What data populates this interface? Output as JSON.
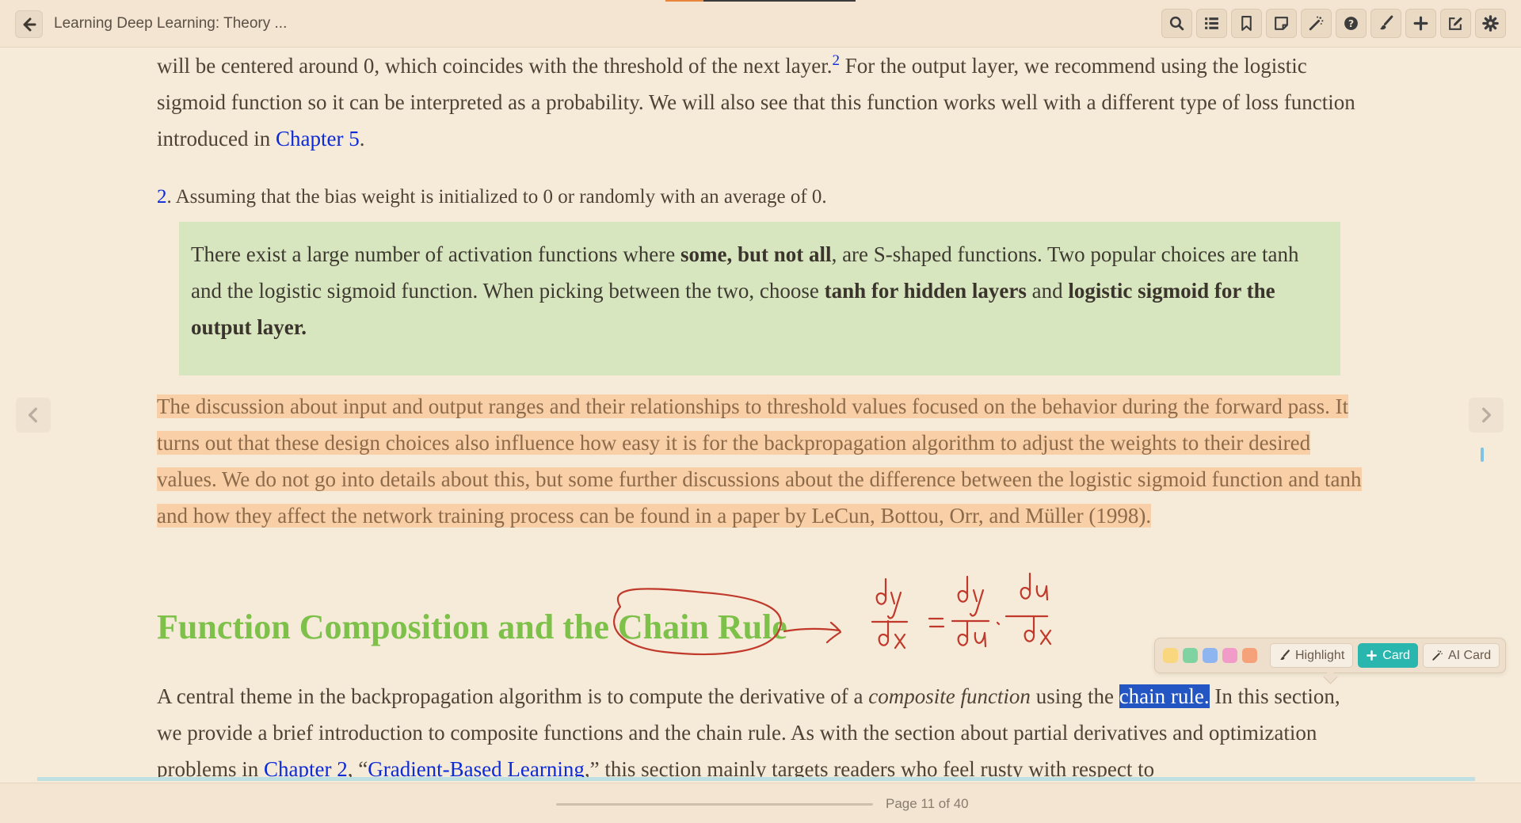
{
  "header": {
    "title": "Learning Deep Learning: Theory ...",
    "toolbar": [
      {
        "name": "search",
        "icon": "search-icon"
      },
      {
        "name": "table-of-contents",
        "icon": "list-icon"
      },
      {
        "name": "bookmarks",
        "icon": "bookmark-icon"
      },
      {
        "name": "notes",
        "icon": "note-icon"
      },
      {
        "name": "ai",
        "icon": "magic-wand-icon"
      },
      {
        "name": "help",
        "icon": "question-icon"
      },
      {
        "name": "draw",
        "icon": "brush-icon"
      },
      {
        "name": "add",
        "icon": "plus-icon"
      },
      {
        "name": "edit",
        "icon": "edit-icon"
      },
      {
        "name": "settings",
        "icon": "gear-icon"
      }
    ]
  },
  "content": {
    "p1": {
      "a": "will be centered around 0, which coincides with the threshold of the next layer.",
      "fn": "2",
      "b": " For the output layer, we recommend using the logistic sigmoid function so it can be interpreted as a probability. We will also see that this function works well with a different type of loss function introduced in ",
      "link": "Chapter 5",
      "c": "."
    },
    "footnote": {
      "num": "2",
      "text": ". Assuming that the bias weight is initialized to 0 or randomly with an average of 0."
    },
    "callout": {
      "t1": "There exist a large number of activation functions where ",
      "b1": "some, but not all",
      "t2": ", are S-shaped functions. Two popular choices are tanh and the logistic sigmoid function. When picking between the two, choose ",
      "b2": "tanh for hidden layers",
      "t3": " and ",
      "b3": "logistic sigmoid for the output layer."
    },
    "highlighted_paragraph": "The discussion about input and output ranges and their relationships to threshold values focused on the behavior during the forward pass. It turns out that these design choices also influence how easy it is for the backpropagation algorithm to adjust the weights to their desired values. We do not go into details about this, but some further discussions about the difference between the logistic sigmoid function and tanh and how they affect the network training process can be found in a paper by LeCun, Bottou, Orr, and Müller (1998).",
    "section_heading": "Function Composition and the Chain Rule",
    "p3": {
      "a": "A central theme in the backpropagation algorithm is to compute the derivative of a ",
      "em": "composite function",
      "b": " using the ",
      "selected": "chain rule.",
      "c": " In this section, we provide a brief introduction to composite functions and the chain rule. As with the section about partial derivatives and optimization problems in ",
      "link1": "Chapter 2",
      "d": ", “",
      "link2": "Gradient-Based Learning",
      "e": ",” this section mainly targets readers who feel rusty with respect to"
    },
    "ink_color": "#c0392b"
  },
  "popup": {
    "swatches": [
      "#f9d77e",
      "#7fd3a0",
      "#8fb5f0",
      "#f09bc8",
      "#f5a27a"
    ],
    "highlight_label": "Highlight",
    "card_label": "Card",
    "ai_card_label": "AI Card"
  },
  "footer": {
    "page_label": "Page 11 of 40",
    "page_progress": 0.275
  },
  "colors": {
    "background": "#f6ead8",
    "heading": "#7dc14a",
    "link": "#0b2ad8",
    "highlight": "#f8cfa6",
    "callout": "#d8e6bf",
    "selection": "#2456c3",
    "card_button": "#28b6ae"
  }
}
